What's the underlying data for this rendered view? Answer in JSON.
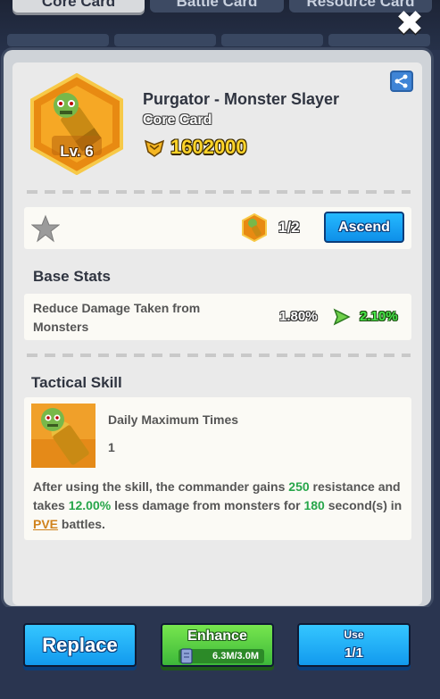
{
  "tabs": [
    {
      "label": "Core Card",
      "active": true
    },
    {
      "label": "Battle Card",
      "active": false
    },
    {
      "label": "Resource Card",
      "active": false
    }
  ],
  "close_icon": "close-x-icon",
  "card": {
    "level": "Lv. 6",
    "name": "Purgator - Monster Slayer",
    "type": "Core Card",
    "power": "1602000"
  },
  "ascend": {
    "count": "1/2",
    "button_label": "Ascend"
  },
  "base_stats": {
    "title": "Base Stats",
    "stat_name": "Reduce Damage Taken from Monsters",
    "old_value": "1.80%",
    "new_value": "2.10%"
  },
  "tactical_skill": {
    "title": "Tactical Skill",
    "label": "Daily Maximum Times",
    "value": "1",
    "desc": {
      "p1": "After using the skill, the commander gains ",
      "v1": "250",
      "p2": " resistance and takes ",
      "v2": "12.00%",
      "p3": " less damage from monsters for ",
      "v3": "180",
      "p4": " second(s) in ",
      "v4": "PVE",
      "p5": " battles."
    }
  },
  "buttons": {
    "replace": "Replace",
    "enhance": "Enhance",
    "enhance_cost": "6.3M/3.0M",
    "use": "Use",
    "use_count": "1/1"
  },
  "colors": {
    "gold": "#ffd42a",
    "green_text": "#27a64a",
    "blue_button": "#129aee",
    "green_button": "#3db83a"
  }
}
